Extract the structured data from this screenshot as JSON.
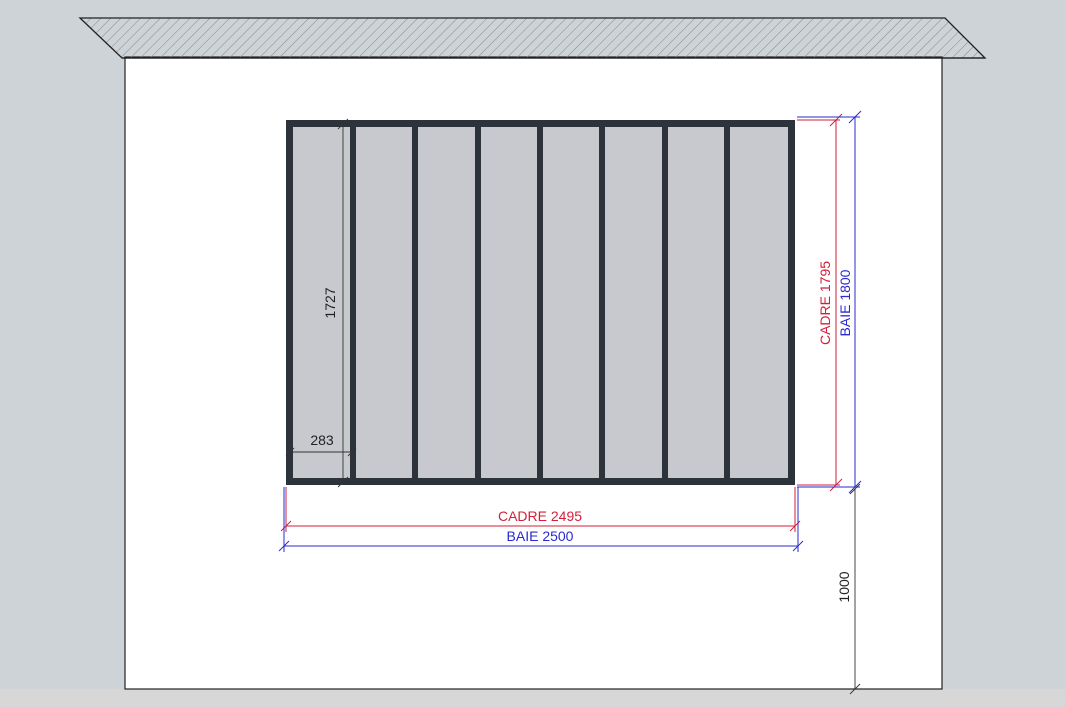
{
  "drawing": {
    "colors": {
      "background": "#cdd3d6",
      "ground": "#d7d7d7",
      "wall": "#ffffff",
      "frame": "#2d333a",
      "glass": "#c7c9ce",
      "cadre_dimension": "#d31f3a",
      "baie_dimension": "#2a2ad0",
      "helper_dimension": "#222222"
    },
    "panel_count": 8,
    "dimensions": {
      "panel_height": "1727",
      "panel_width": "283",
      "cadre_height": "CADRE 1795",
      "baie_height": "BAIE 1800",
      "cadre_width": "CADRE 2495",
      "baie_width": "BAIE 2500",
      "sill_height": "1000"
    }
  }
}
